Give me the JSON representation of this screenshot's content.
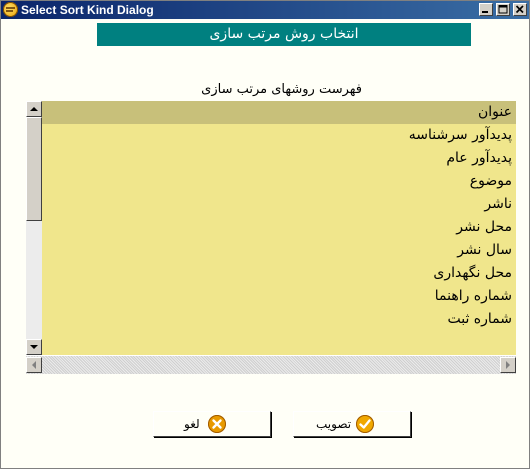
{
  "window": {
    "title": "Select Sort Kind Dialog"
  },
  "header": {
    "banner": "انتخاب روش مرتب سازی"
  },
  "list": {
    "caption": "فهرست روشهای مرتب سازی",
    "selected_index": 0,
    "items": [
      "عنوان",
      "پدیدآور سرشناسه",
      "پدیدآور عام",
      "موضوع",
      "ناشر",
      "محل نشر",
      "سال نشر",
      "محل نگهداری",
      "شماره راهنما",
      "شماره ثبت"
    ]
  },
  "buttons": {
    "cancel_label": "لغو",
    "ok_label": "تصویب"
  },
  "icons": {
    "app": "app-emblem-icon",
    "minimize": "minimize-icon",
    "maximize": "maximize-icon",
    "close": "close-icon",
    "cancel": "cancel-x-icon",
    "ok": "checkmark-icon"
  },
  "colors": {
    "titlebar": "#0a246a",
    "banner": "#008080",
    "list_background": "#f0e68c",
    "selected_row": "#c8c07a",
    "cancel_icon": "#e89a00",
    "ok_icon": "#f0a800"
  }
}
